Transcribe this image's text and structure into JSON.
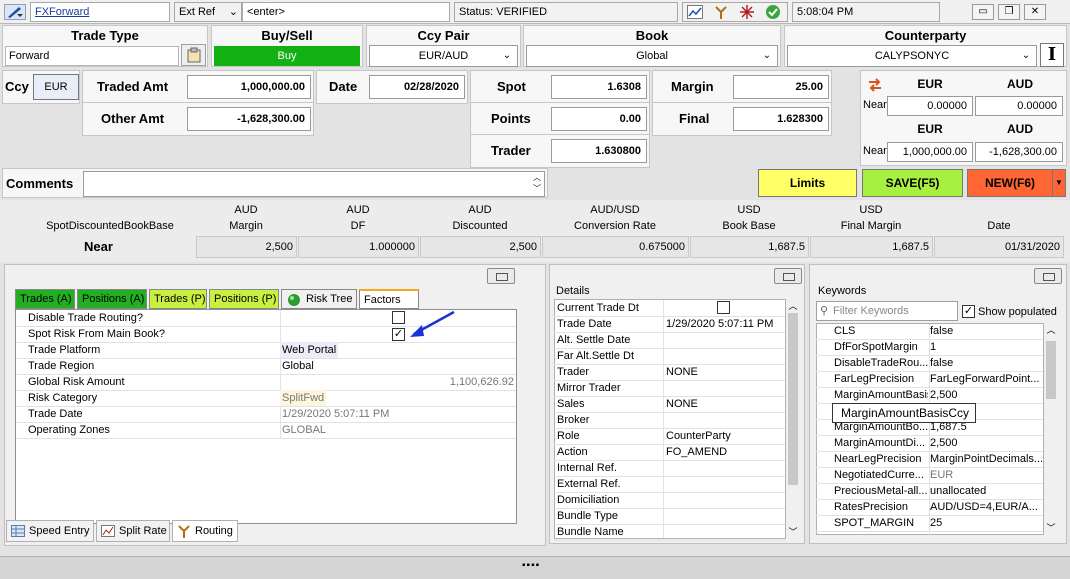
{
  "titlebar": {
    "app_name": "FXForward",
    "ext_ref_label": "Ext Ref",
    "ext_ref_value": "<enter>",
    "status": "Status: VERIFIED",
    "time": "5:08:04 PM"
  },
  "trade_type": {
    "label": "Trade Type",
    "value": "Forward"
  },
  "buy_sell": {
    "label": "Buy/Sell",
    "value": "Buy"
  },
  "ccy_pair": {
    "label": "Ccy Pair",
    "value": "EUR/AUD"
  },
  "book": {
    "label": "Book",
    "value": "Global"
  },
  "counterparty": {
    "label": "Counterparty",
    "value": "CALYPSONYC"
  },
  "ccy": {
    "label": "Ccy",
    "value": "EUR"
  },
  "traded_amt": {
    "label": "Traded Amt",
    "value": "1,000,000.00"
  },
  "other_amt": {
    "label": "Other Amt",
    "value": "-1,628,300.00"
  },
  "date": {
    "label": "Date",
    "value": "02/28/2020"
  },
  "spot": {
    "label": "Spot",
    "value": "1.6308"
  },
  "points": {
    "label": "Points",
    "value": "0.00"
  },
  "trader": {
    "label": "Trader",
    "value": "1.630800"
  },
  "margin": {
    "label": "Margin",
    "value": "25.00"
  },
  "final": {
    "label": "Final",
    "value": "1.628300"
  },
  "near_box": {
    "ccy1": "EUR",
    "ccy2": "AUD",
    "near1_label": "Near",
    "near1_v1": "0.00000",
    "near1_v2": "0.00000",
    "ccy3": "EUR",
    "ccy4": "AUD",
    "near2_label": "Near",
    "near2_v1": "1,000,000.00",
    "near2_v2": "-1,628,300.00"
  },
  "comments": {
    "label": "Comments",
    "value": ""
  },
  "buttons": {
    "limits": "Limits",
    "save": "SAVE(F5)",
    "new": "NEW(F6)"
  },
  "summary": {
    "row_label_header": "SpotDiscountedBookBase",
    "row_label": "Near",
    "columns": [
      {
        "ccy": "AUD",
        "name": "Margin",
        "value": "2,500"
      },
      {
        "ccy": "AUD",
        "name": "DF",
        "value": "1.000000"
      },
      {
        "ccy": "AUD",
        "name": "Discounted",
        "value": "2,500"
      },
      {
        "ccy": "AUD/USD",
        "name": "Conversion Rate",
        "value": "0.675000"
      },
      {
        "ccy": "USD",
        "name": "Book Base",
        "value": "1,687.5"
      },
      {
        "ccy": "USD",
        "name": "Final Margin",
        "value": "1,687.5"
      },
      {
        "ccy": "",
        "name": "Date",
        "value": "01/31/2020"
      }
    ]
  },
  "left_tabs": [
    "Trades (A)",
    "Positions (A)",
    "Trades (P)",
    "Positions (P)",
    "Risk Tree",
    "Factors"
  ],
  "factors": [
    {
      "name": "Disable Trade Routing?",
      "value": "",
      "type": "checkbox",
      "checked": false
    },
    {
      "name": "Spot Risk From Main Book?",
      "value": "",
      "type": "checkbox",
      "checked": true
    },
    {
      "name": "Trade Platform",
      "value": "Web Portal"
    },
    {
      "name": "Trade Region",
      "value": "Global"
    },
    {
      "name": "Global Risk Amount",
      "value": "1,100,626.92"
    },
    {
      "name": "Risk Category",
      "value": "SplitFwd"
    },
    {
      "name": "Trade Date",
      "value": "1/29/2020 5:07:11 PM"
    },
    {
      "name": "Operating Zones",
      "value": "GLOBAL"
    }
  ],
  "details": {
    "title": "Details",
    "rows": [
      {
        "name": "Current Trade Dt",
        "value": "",
        "checkbox": true
      },
      {
        "name": "Trade Date",
        "value": "1/29/2020 5:07:11 PM"
      },
      {
        "name": "Alt. Settle Date",
        "value": ""
      },
      {
        "name": "Far Alt.Settle Dt",
        "value": ""
      },
      {
        "name": "Trader",
        "value": "NONE"
      },
      {
        "name": "Mirror Trader",
        "value": ""
      },
      {
        "name": "Sales",
        "value": "NONE"
      },
      {
        "name": "Broker",
        "value": ""
      },
      {
        "name": "Role",
        "value": "CounterParty"
      },
      {
        "name": "Action",
        "value": "FO_AMEND"
      },
      {
        "name": "Internal Ref.",
        "value": ""
      },
      {
        "name": "External Ref.",
        "value": ""
      },
      {
        "name": "Domiciliation",
        "value": ""
      },
      {
        "name": "Bundle Type",
        "value": ""
      },
      {
        "name": "Bundle Name",
        "value": ""
      }
    ]
  },
  "keywords": {
    "title": "Keywords",
    "filter_placeholder": "Filter Keywords",
    "show_populated": "Show populated",
    "tooltip": "MarginAmountBasisCcy",
    "rows": [
      {
        "name": "CLS",
        "value": "false"
      },
      {
        "name": "DfForSpotMargin",
        "value": "1"
      },
      {
        "name": "DisableTradeRou...",
        "value": "false"
      },
      {
        "name": "FarLegPrecision",
        "value": "FarLegForwardPoint..."
      },
      {
        "name": "MarginAmountBasis",
        "value": "2,500"
      },
      {
        "name": "",
        "value": ""
      },
      {
        "name": "MarginAmountBo...",
        "value": "1,687.5"
      },
      {
        "name": "MarginAmountDi...",
        "value": "2,500"
      },
      {
        "name": "NearLegPrecision",
        "value": "MarginPointDecimals..."
      },
      {
        "name": "NegotiatedCurre...",
        "value": "EUR"
      },
      {
        "name": "PreciousMetal-all...",
        "value": "unallocated"
      },
      {
        "name": "RatesPrecision",
        "value": "AUD/USD=4,EUR/A..."
      },
      {
        "name": "SPOT_MARGIN",
        "value": "25"
      }
    ]
  },
  "bottom_tabs": [
    "Speed Entry",
    "Split Rate",
    "Routing"
  ]
}
